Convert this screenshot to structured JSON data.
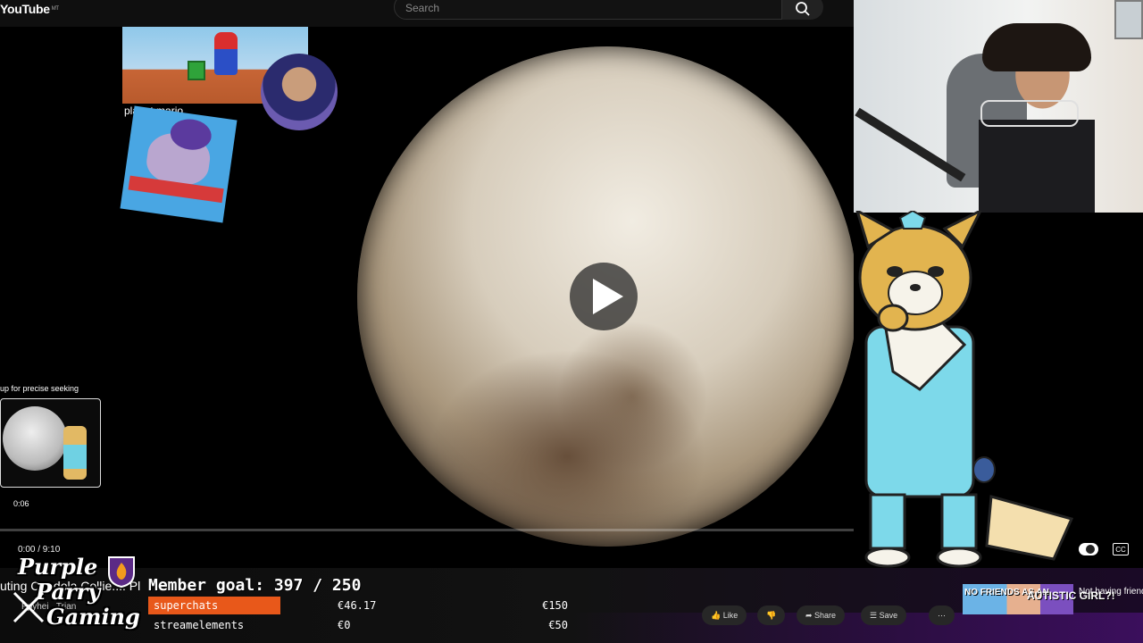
{
  "header": {
    "logo_text": "YouTube",
    "logo_sup": "MT",
    "search_placeholder": "Search"
  },
  "video": {
    "current_time": "0:00",
    "duration": "9:10",
    "time_display": "0:00 / 9:10",
    "progress_fraction": 0.0,
    "title": "uting Candola Collie...: Pl",
    "channel": "Ppyhei...Trian"
  },
  "overlays": {
    "mario_label": "planet mario",
    "seek_tip": "up for precise seeking",
    "seek_time": "0:06"
  },
  "stream_logo": {
    "line1": "Purple",
    "line2": "Parry",
    "line3": "Gaming"
  },
  "goals": {
    "member_goal_text": "Member goal: 397 / 250",
    "rows": [
      {
        "label": "superchats",
        "current": "€46.17",
        "target": "€150",
        "fill_fraction": 0.31,
        "color": "#e8581a"
      },
      {
        "label": "streamelements",
        "current": "€0",
        "target": "€50",
        "fill_fraction": 0.0,
        "color": "#e8581a"
      }
    ]
  },
  "actions": [
    {
      "label": "Like",
      "icon": "thumbs-up-icon"
    },
    {
      "label": "",
      "icon": "thumbs-down-icon"
    },
    {
      "label": "Share",
      "icon": "share-icon"
    },
    {
      "label": "Save",
      "icon": "save-icon"
    },
    {
      "label": "",
      "icon": "more-icon"
    }
  ],
  "recommendation": {
    "thumb_text1": "NO FRIENDS AS AN",
    "thumb_text2": "AUTISTIC GIRL?!",
    "title": "Not having friends as an autistic girl?! My story of"
  },
  "colors": {
    "progress": "#ff0000",
    "goal_fill": "#e8581a",
    "accent_purple": "#3b0f5c"
  }
}
